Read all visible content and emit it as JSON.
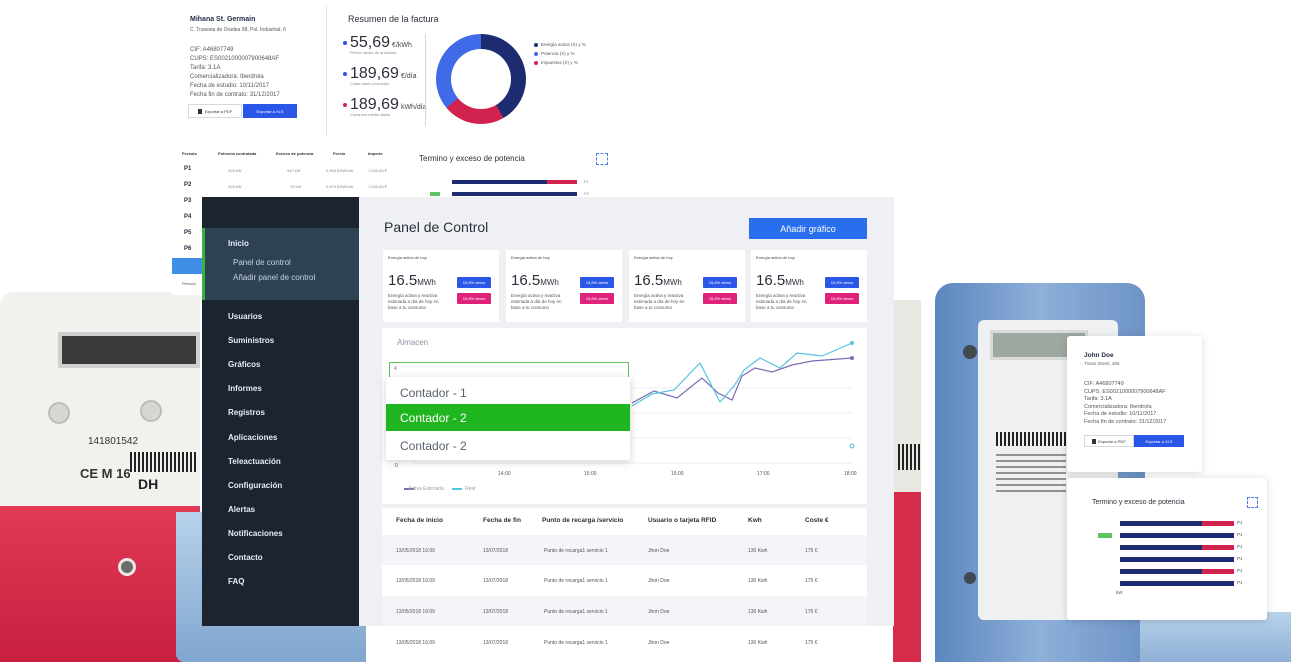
{
  "invoice": {
    "company": "Mihana St. Germain",
    "address": "C. Travesia de Oradea 58, Pol. Industrial, 6",
    "details": [
      "CIF: A46807749",
      "CUPS: ES0021000007900648AF",
      "Tarifa: 3.1A",
      "Comercializadora: Iberdrola",
      "Fecha de estudio: 10/11/2017",
      "Fecha fin de contrato: 31/12/2017"
    ],
    "export_pdf": "Exportar a PDF",
    "export_xls": "Exportar a XLS",
    "summary_title": "Resumen de la factura",
    "stats": [
      {
        "value": "55,69",
        "unit": "€/kWh",
        "sub": "Precio medio de la factura"
      },
      {
        "value": "189,69",
        "unit": "€/día",
        "sub": "Coste diario promedio"
      },
      {
        "value": "189,69",
        "unit": "kWh/día",
        "sub": "Consumo medio diario"
      }
    ],
    "legend": [
      "Energía activa (X) y %",
      "Potencia (X) y %",
      "Impuestos (X) y %"
    ],
    "donut_colors": {
      "a": "#1d2b70",
      "b": "#d2234e",
      "c": "#3f6be8"
    }
  },
  "periods": {
    "headers": [
      "Periodo",
      "Potencia contratada",
      "Exceso de potencia",
      "Precio",
      "Importe"
    ],
    "rows": [
      {
        "label": "P1",
        "cells": [
          "328 kW",
          "942 kW",
          "0,903 €/kW/día",
          "1.042,63 €"
        ]
      },
      {
        "label": "P2",
        "cells": [
          "328 kW",
          "76 kW",
          "0,876 €/kW/día",
          "1.042,63 €"
        ]
      },
      {
        "label": "P3",
        "cells": []
      },
      {
        "label": "P4",
        "cells": []
      },
      {
        "label": "P5",
        "cells": []
      },
      {
        "label": "P6",
        "cells": []
      }
    ],
    "footer": "Periodo"
  },
  "termino_exceso": {
    "title": "Termino y exceso de potencia",
    "labels": [
      "P1",
      "P2",
      "P3",
      "P4",
      "P5",
      "P6"
    ],
    "axis_label": "kW"
  },
  "sidebar": {
    "items": [
      {
        "label": "Inicio"
      },
      {
        "label": "Usuarios"
      },
      {
        "label": "Suministros"
      },
      {
        "label": "Gráficos"
      },
      {
        "label": "Informes"
      },
      {
        "label": "Registros"
      },
      {
        "label": "Aplicaciones"
      },
      {
        "label": "Teleactuación"
      },
      {
        "label": "Configuración"
      },
      {
        "label": "Alertas"
      },
      {
        "label": "Notificaciones"
      },
      {
        "label": "Contacto"
      },
      {
        "label": "FAQ"
      }
    ],
    "subitems": [
      "Panel de control",
      "Añadir panel de control"
    ],
    "accent": "#3ab33a"
  },
  "main": {
    "title": "Panel de Control",
    "add_button": "Añadir gráfico",
    "kpis": [
      {
        "title": "Energía activa de hoy",
        "value": "16.5",
        "unit": "MWh",
        "desc": "Energía activa y reactiva estimada a día de hoy en base a tu consumo",
        "badge1": "15,6% demo",
        "badge2": "15,6% demo"
      },
      {
        "title": "Energía activa de hoy",
        "value": "16.5",
        "unit": "MWh",
        "desc": "Energía activa y reactiva estimada a día de hoy en base a tu consumo",
        "badge1": "15,6% demo",
        "badge2": "15,6% demo"
      },
      {
        "title": "Energía activa de hoy",
        "value": "16.5",
        "unit": "MWh",
        "desc": "Energía activa y reactiva estimada a día de hoy en base a tu consumo",
        "badge1": "15,6% demo",
        "badge2": "15,6% demo"
      },
      {
        "title": "Energía activa de hoy",
        "value": "16.5",
        "unit": "MWh",
        "desc": "Energía activa y reactiva estimada a día de hoy en base a tu consumo",
        "badge1": "15,6% demo",
        "badge2": "15,6% demo"
      }
    ],
    "chart": {
      "title": "Almacen",
      "dropdown_value": "4",
      "options": [
        "Contador - 1",
        "Contador - 2",
        "Contador - 2"
      ],
      "selected_index": 1,
      "legend": [
        "Activa Estimada",
        "Real"
      ],
      "series_colors": {
        "a": "#7b6bb5",
        "b": "#56c4e0"
      },
      "xticks": [
        "13:00",
        "14:00",
        "15:00",
        "16:00",
        "17:00",
        "18:00"
      ],
      "ytick0": "0"
    },
    "table": {
      "headers": [
        "Fecha de inicio",
        "Fecha de fin",
        "Punto de recarga /servicio",
        "Usuario o tarjeta RFID",
        "Kwh",
        "Coste €"
      ],
      "rows": [
        [
          "13/05/2018 16:09",
          "13/07/2018",
          "Punto de recarga1 servicio 1",
          "Jhon Doe",
          "130 Kwh",
          "175 €"
        ],
        [
          "13/05/2018 16:09",
          "13/07/2018",
          "Punto de recarga1 servicio 1",
          "Jhon Doe",
          "130 Kwh",
          "175 €"
        ],
        [
          "13/05/2018 16:09",
          "13/07/2018",
          "Punto de recarga1 servicio 1",
          "Jhon Doe",
          "130 Kwh",
          "175 €"
        ],
        [
          "13/05/2018 16:09",
          "13/07/2018",
          "Punto de recarga1 servicio 1",
          "Jhon Doe",
          "130 Kwh",
          "175 €"
        ]
      ]
    }
  },
  "johndoe": {
    "name": "John Doe",
    "address": "Travis Street, 486",
    "details": [
      "CIF: A46807749",
      "CUPS: ES0021000007900648AF",
      "Tarifa: 3.1A",
      "Comercializadora: Iberdrola",
      "Fecha de estudio: 10/11/2017",
      "Fecha fin de contrato: 31/12/2017"
    ],
    "export_pdf": "Exportar a PDF",
    "export_xls": "Exportar a XLS"
  },
  "termino_exceso_2": {
    "title": "Termino y exceso de potencia",
    "labels": [
      "P1",
      "P1",
      "P1",
      "P1",
      "P1",
      "P1"
    ],
    "axis_label": "kW"
  },
  "meters": {
    "left_serial": "141801542",
    "left_brand": "DH",
    "left_ce": "CE M 16"
  }
}
